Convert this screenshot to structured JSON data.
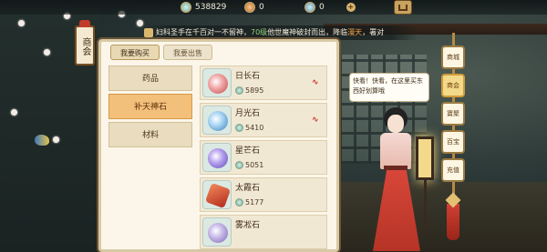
{
  "topbar": {
    "resources": [
      {
        "icon": "jade-coin-icon",
        "value": "538829"
      },
      {
        "icon": "copper-coin-icon",
        "value": "0"
      },
      {
        "icon": "fish-token-icon",
        "value": "0"
      }
    ]
  },
  "marquee": {
    "before_a": "妇科圣手在千百对一不留神，",
    "highlight_a": "70级",
    "before_b": "他世魔神破封而出，降临",
    "highlight_b": "漫天",
    "after": "，署对"
  },
  "shop_sign": {
    "text": "商会"
  },
  "tabs": [
    {
      "label": "我要购买",
      "active": true
    },
    {
      "label": "我要出售",
      "active": false
    }
  ],
  "categories": [
    {
      "label": "药品",
      "active": false
    },
    {
      "label": "补天神石",
      "active": true
    },
    {
      "label": "材料",
      "active": false
    }
  ],
  "items": [
    {
      "name": "日长石",
      "price": "5895",
      "gem": "ri",
      "trend": true
    },
    {
      "name": "月光石",
      "price": "5410",
      "gem": "yue",
      "trend": true
    },
    {
      "name": "星芒石",
      "price": "5051",
      "gem": "xing",
      "trend": false
    },
    {
      "name": "太霞石",
      "price": "5177",
      "gem": "tai",
      "trend": false
    },
    {
      "name": "雾凇石",
      "price": "",
      "gem": "wu",
      "trend": false
    }
  ],
  "right_menu": [
    {
      "label": "商城",
      "active": false
    },
    {
      "label": "商会",
      "active": true
    },
    {
      "label": "寶聚",
      "active": false
    },
    {
      "label": "百宝",
      "active": false
    },
    {
      "label": "充值",
      "active": false
    }
  ],
  "npc": {
    "speech": "快看！快看，在这里买东西好划算哦"
  }
}
